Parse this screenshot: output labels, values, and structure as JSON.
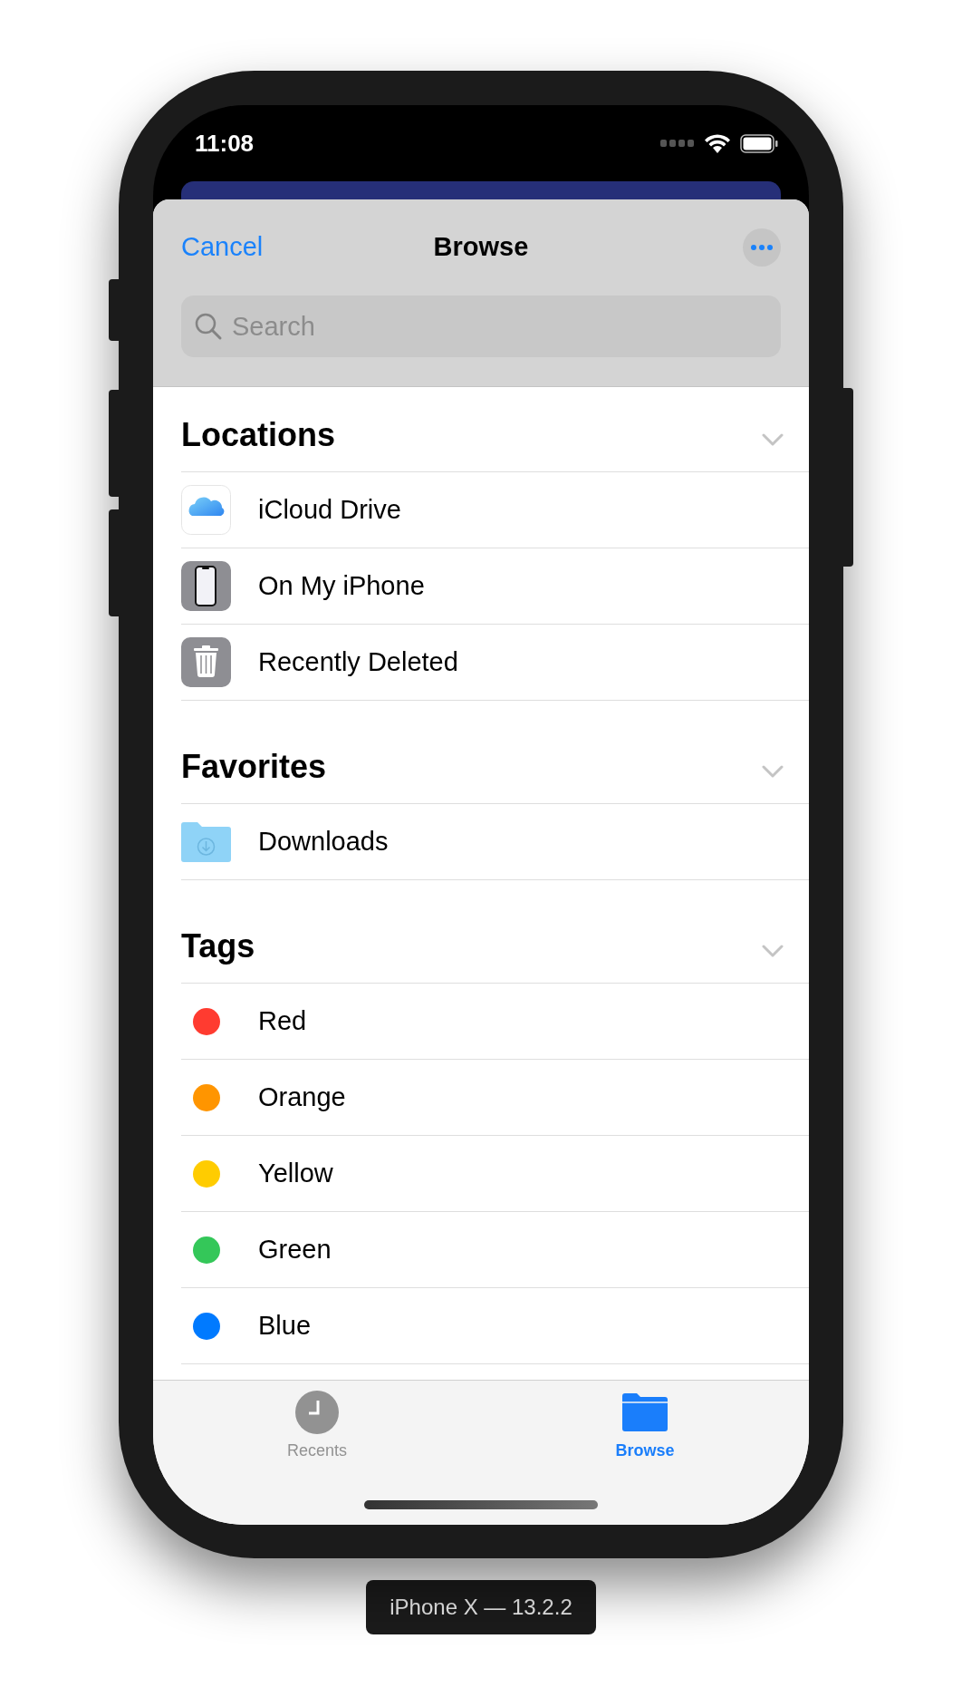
{
  "status_bar": {
    "time": "11:08"
  },
  "nav": {
    "cancel": "Cancel",
    "title": "Browse"
  },
  "search": {
    "placeholder": "Search"
  },
  "sections": [
    {
      "title": "Locations",
      "items": [
        {
          "kind": "icloud",
          "label": "iCloud Drive"
        },
        {
          "kind": "phone",
          "label": "On My iPhone"
        },
        {
          "kind": "trash",
          "label": "Recently Deleted"
        }
      ]
    },
    {
      "title": "Favorites",
      "items": [
        {
          "kind": "folder",
          "label": "Downloads"
        }
      ]
    },
    {
      "title": "Tags",
      "items": [
        {
          "kind": "tag",
          "label": "Red",
          "color": "#ff3b30"
        },
        {
          "kind": "tag",
          "label": "Orange",
          "color": "#ff9500"
        },
        {
          "kind": "tag",
          "label": "Yellow",
          "color": "#ffcc00"
        },
        {
          "kind": "tag",
          "label": "Green",
          "color": "#34c759"
        },
        {
          "kind": "tag",
          "label": "Blue",
          "color": "#007aff"
        }
      ]
    }
  ],
  "tabs": [
    {
      "kind": "recents",
      "label": "Recents",
      "selected": false
    },
    {
      "kind": "browse",
      "label": "Browse",
      "selected": true
    }
  ],
  "device_label": "iPhone X — 13.2.2"
}
